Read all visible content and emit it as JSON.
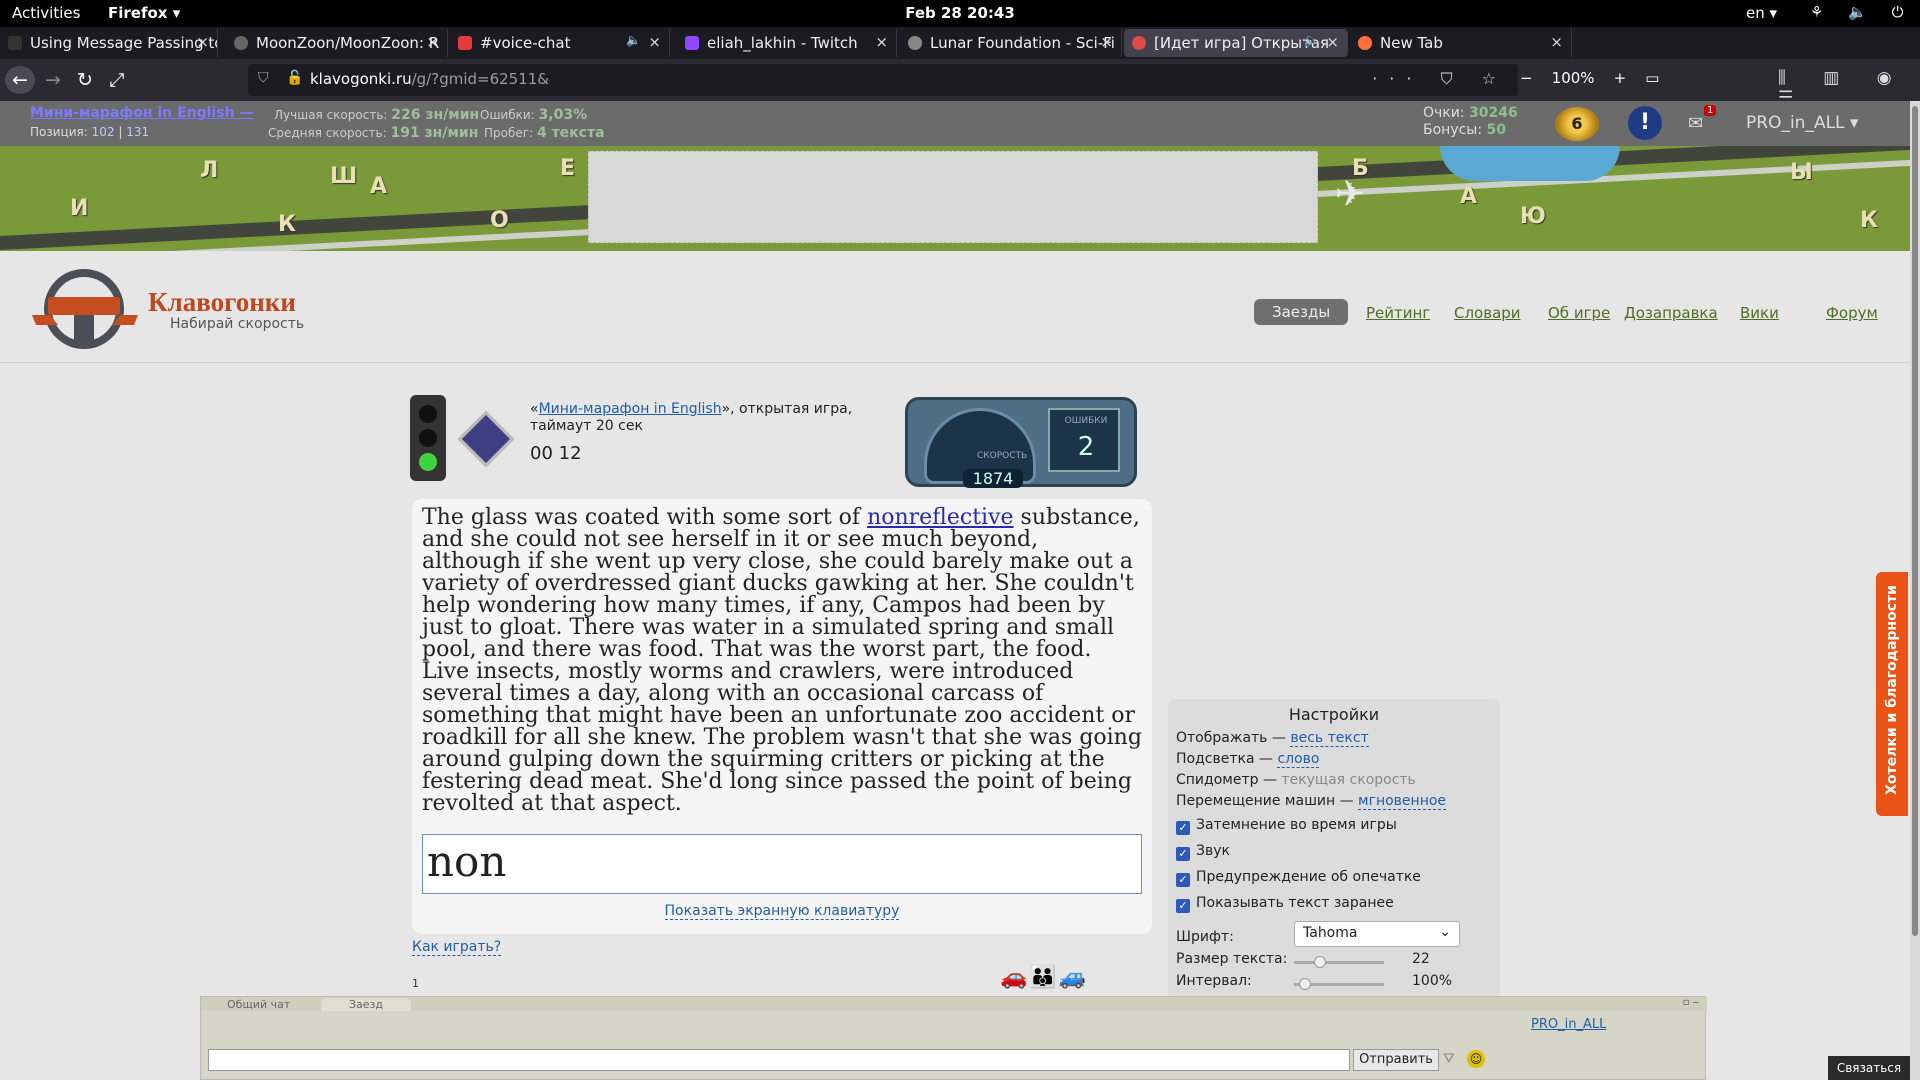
{
  "os": {
    "activities": "Activities",
    "app": "Firefox ▾",
    "clock": "Feb 28  20:43",
    "lang": "en ▾",
    "tray": "⚘ 🔈 ⏻ ▾"
  },
  "tabs": [
    {
      "label": "Using Message Passing to",
      "color": "#333",
      "speaker": ""
    },
    {
      "label": "MoonZoon/MoonZoon: R",
      "color": "#666",
      "speaker": ""
    },
    {
      "label": "#voice-chat",
      "color": "#e23b3b",
      "speaker": "🔈"
    },
    {
      "label": "eliah_lakhin - Twitch",
      "color": "#9146ff",
      "speaker": ""
    },
    {
      "label": "Lunar Foundation - Sci-Fi",
      "color": "#888",
      "speaker": ""
    },
    {
      "label": "[Идет игра] Открытая",
      "color": "#e04848",
      "speaker": "🔈"
    },
    {
      "label": "New Tab",
      "color": "#ff7139",
      "speaker": ""
    }
  ],
  "tab_close": "×",
  "nav": {
    "url_host": "klavogonki.ru",
    "url_rest": "/g/?gmid=62511&",
    "zoom": "100%"
  },
  "userbar": {
    "game_name": "Мини-марафон in English —",
    "position_label": "Позиция:",
    "pos_a": "102",
    "pos_b": "131",
    "best_label": "Лучшая скорость:",
    "best_value": "226 зн/мин",
    "avg_label": "Средняя скорость:",
    "avg_value": "191 зн/мин",
    "errors_label": "Ошибки:",
    "errors_value": "3,03%",
    "runs_label": "Пробег:",
    "runs_value": "4 текста",
    "points_label": "Очки:",
    "points_value": "30246",
    "bonus_label": "Бонусы:",
    "bonus_value": "50",
    "level": "6",
    "mail_count": "1",
    "username": "PRO_in_ALL ▾"
  },
  "banner_letters": [
    "Л",
    "И",
    "Ш",
    "А",
    "Е",
    "О",
    "К",
    "Б",
    "А",
    "Ю",
    "Ы",
    "К"
  ],
  "logo": {
    "name": "Клавогонки",
    "tagline": "Набирай скорость"
  },
  "menu": [
    "Заезды",
    "Рейтинг",
    "Словари",
    "Об игре",
    "Дозаправка",
    "Вики",
    "Форум"
  ],
  "game": {
    "quote_open": "«",
    "link": "Мини-марафон in English",
    "desc": "», открытая игра,",
    "timeout": "таймаут 20 сек",
    "timer": "00 12",
    "speed_label": "СКОРОСТЬ",
    "speed_value": "1874",
    "errors_label": "ОШИБКИ",
    "errors_value": "2"
  },
  "text": {
    "before": "The glass was coated with some sort of ",
    "current": "nonreflective",
    "after": " substance, and she could not see herself in it or see much beyond, although if she went up very close, she could barely make out a variety of overdressed giant ducks gawking at her. She couldn't help wondering how many times, if any, Campos had been by just to gloat. There was water in a simulated spring and small pool, and there was food. That was the worst part, the food. Live insects, mostly worms and crawlers, were introduced several times a day, along with an occasional carcass of something that might have been an unfortunate zoo accident or roadkill for all she knew. The problem wasn't that she was going around gulping down the squirming critters or picking at the festering dead meat. She'd long since passed the point of being revolted at that aspect.",
    "typed": "non",
    "show_keyboard": "Показать экранную клавиатуру",
    "how_to": "Как играть?"
  },
  "settings": {
    "title": "Настройки",
    "display_label": "Отображать — ",
    "display_value": "весь текст",
    "highlight_label": "Подсветка — ",
    "highlight_value": "слово",
    "speedo_label": "Спидометр — ",
    "speedo_value": "текущая скорость",
    "move_label": "Перемещение машин — ",
    "move_value": "мгновенное",
    "check_dim": "Затемнение во время игры",
    "check_sound": "Звук",
    "check_warn": "Предупреждение об опечатке",
    "check_preview": "Показывать текст заранее",
    "checkmark": "✓",
    "font_label": "Шрифт:",
    "font_value": "Tahoma",
    "size_label": "Размер текста:",
    "size_value": "22",
    "size_level": 0.22,
    "interval_label": "Интервал:",
    "interval_value": "100%",
    "interval_level": 0.05
  },
  "feedback": "Хотелки и благодарности",
  "chat": {
    "tab_general": "Общий чат",
    "tab_race": "Заезд",
    "send": "Отправить",
    "user": "PRO_in_ALL",
    "win_btns": "▫ ‒"
  },
  "contact": "Связаться",
  "race_num": "1"
}
